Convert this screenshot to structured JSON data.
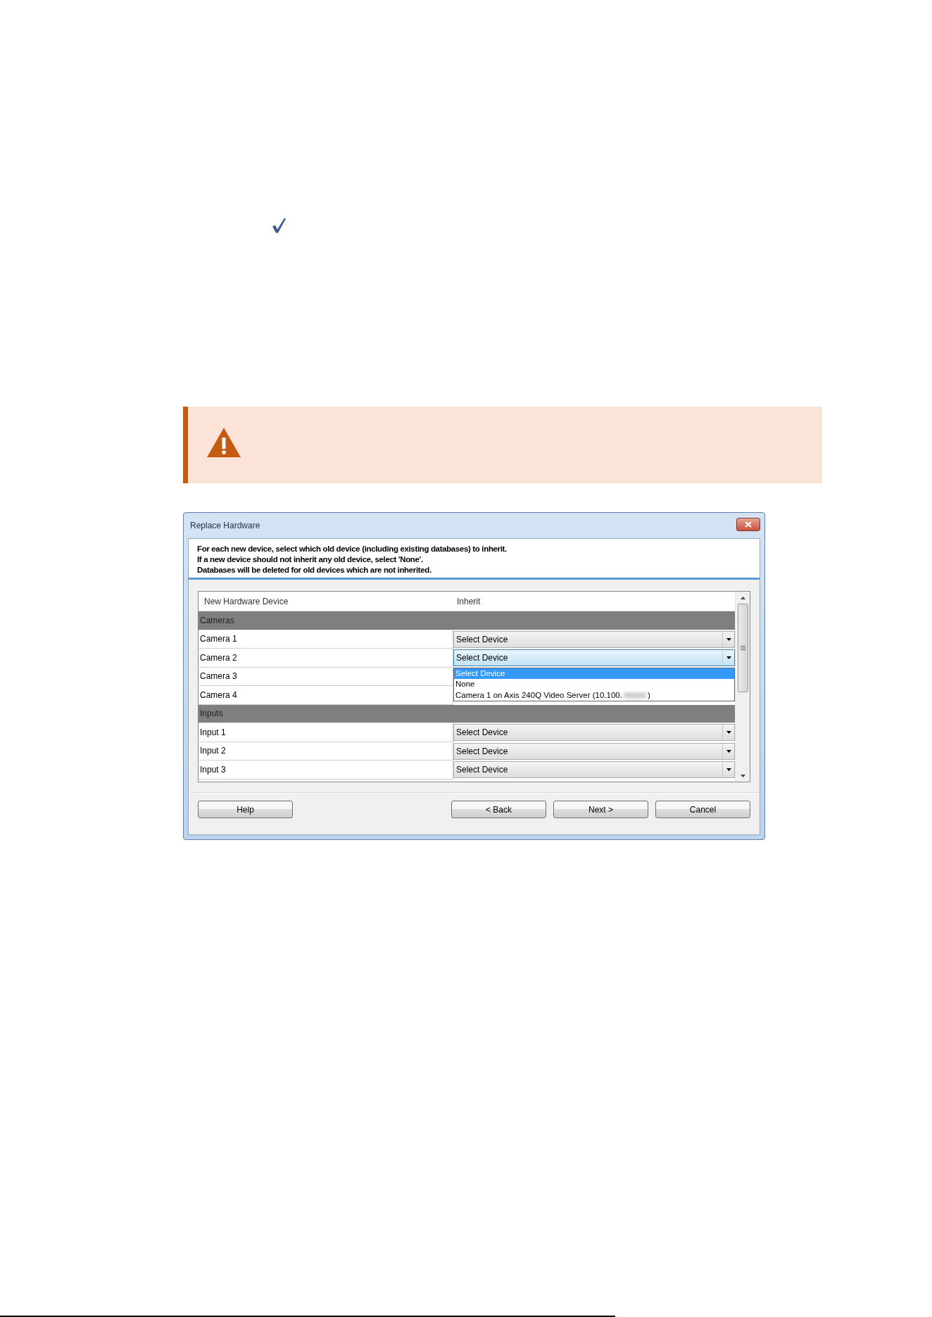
{
  "check_mark": {
    "kind": "check"
  },
  "callout": {
    "kind": "warning"
  },
  "dialog": {
    "title": "Replace Hardware",
    "instructions": [
      "For each new device, select which old device (including existing databases) to inherit.",
      "If a new device should not inherit any old device, select 'None'.",
      "Databases will be deleted for old devices which are not inherited."
    ],
    "columns": [
      "New Hardware Device",
      "Inherit"
    ],
    "rows": [
      {
        "kind": "group",
        "label": "Cameras"
      },
      {
        "kind": "device",
        "label": "Camera 1",
        "value": "Select Device",
        "focused": false
      },
      {
        "kind": "device",
        "label": "Camera 2",
        "value": "Select Device",
        "focused": true,
        "dropdown": {
          "options": [
            {
              "label": "Select Device",
              "selected": true
            },
            {
              "label": "None",
              "selected": false
            },
            {
              "label": "Camera 1 on Axis 240Q Video Server (10.100.",
              "suffix": ")",
              "redacted": true,
              "selected": false
            }
          ]
        }
      },
      {
        "kind": "device",
        "label": "Camera 3"
      },
      {
        "kind": "device",
        "label": "Camera 4"
      },
      {
        "kind": "group",
        "label": "Inputs"
      },
      {
        "kind": "device",
        "label": "Input 1",
        "value": "Select Device",
        "focused": false
      },
      {
        "kind": "device",
        "label": "Input 2",
        "value": "Select Device",
        "focused": false
      },
      {
        "kind": "device",
        "label": "Input 3",
        "value": "Select Device",
        "focused": false
      }
    ],
    "buttons": [
      {
        "label": "Help",
        "kind": "left"
      },
      {
        "label": "< Back",
        "kind": "right"
      },
      {
        "label": "Next >",
        "kind": "right"
      },
      {
        "label": "Cancel",
        "kind": "right"
      }
    ]
  }
}
